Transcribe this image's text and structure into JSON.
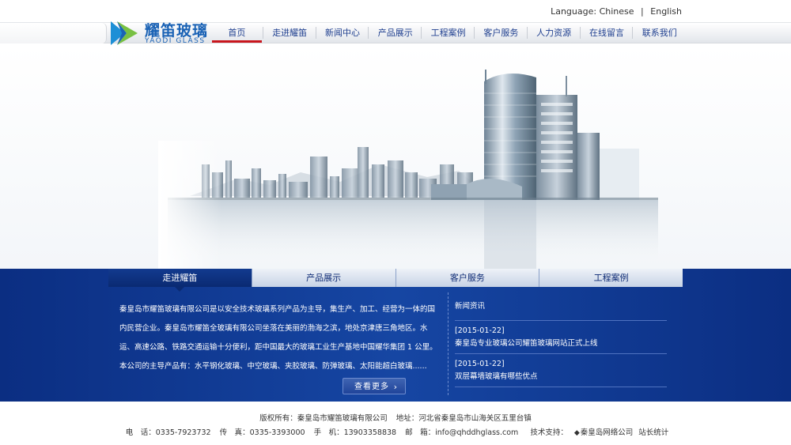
{
  "header": {
    "language_label": "Language:",
    "lang_chinese": "Chinese",
    "lang_separator": "|",
    "lang_english": "English",
    "logo_cn": "耀笛玻璃",
    "logo_en": "YAODI GLASS"
  },
  "nav": {
    "items": [
      "首页",
      "走进耀笛",
      "新闻中心",
      "产品展示",
      "工程案例",
      "客户服务",
      "人力资源",
      "在线留言",
      "联系我们"
    ],
    "active_index": 0
  },
  "tabs": {
    "items": [
      "走进耀笛",
      "产品展示",
      "客户服务",
      "工程案例"
    ],
    "active_index": 0
  },
  "about": {
    "text": "秦皇岛市耀笛玻璃有限公司是以安全技术玻璃系列产品为主导，集生产、加工、经营为一体的国内民营企业。秦皇岛市耀笛全玻璃有限公司坐落在美丽的渤海之滨，地处京津唐三角地区。水运、高速公路、铁路交通运输十分便利，距中国最大的玻璃工业生产基地中国耀华集团 1 公里。本公司的主导产品有：水平钢化玻璃、中空玻璃、夹胶玻璃、防弹玻璃、太阳能超白玻璃......",
    "more_label": "查看更多",
    "more_chevron": "›"
  },
  "news": {
    "title": "新闻资讯",
    "items": [
      {
        "date": "[2015-01-22]",
        "text": "秦皇岛专业玻璃公司耀笛玻璃网站正式上线"
      },
      {
        "date": "[2015-01-22]",
        "text": "双层幕墙玻璃有哪些优点"
      }
    ]
  },
  "footer": {
    "copyright": "版权所有：秦皇岛市耀笛玻璃有限公司",
    "address": "地址：河北省秦皇岛市山海关区五里台镇",
    "phone": "电　话：0335-7923732",
    "fax": "传　真：0335-3393000",
    "mobile": "手　机：13903358838",
    "email": "邮　箱：info@qhddhglass.com",
    "support_label": "技术支持：",
    "support_icon": "◆",
    "support_company": "秦皇岛网络公司",
    "stats": "站长统计"
  },
  "colors": {
    "brand_blue": "#1a62b5",
    "nav_text": "#1f3f8f",
    "active_red": "#c9161d",
    "section_blue": "#0b2e82"
  }
}
